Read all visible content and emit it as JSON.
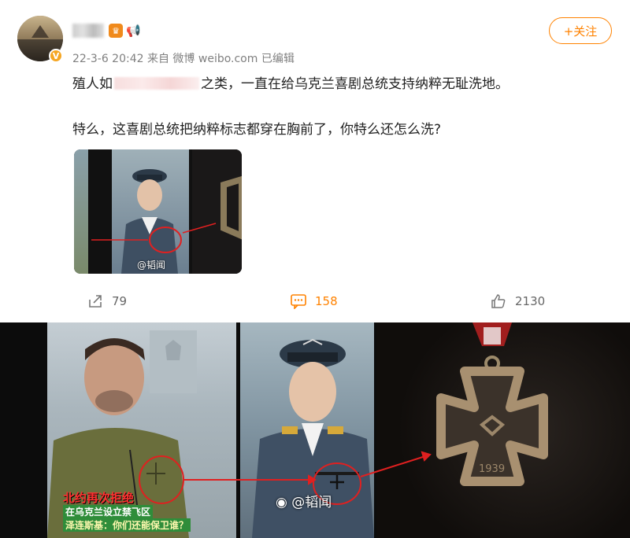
{
  "post": {
    "username_redacted": true,
    "verified_badge": "V",
    "level_badge": "♛",
    "meta": "22-3-6 20:42 来自 微博 weibo.com 已编辑",
    "follow_label": "+关注",
    "line1_before": "殖人如",
    "line1_after": "之类，一直在给乌克兰喜剧总统支持纳粹无耻洗地。",
    "line2": "特么，这喜剧总统把纳粹标志都穿在胸前了，你特么还怎么洗?",
    "thumb_watermark": "@韬闻",
    "actions": {
      "share_count": "79",
      "comment_count": "158",
      "like_count": "2130"
    }
  },
  "large_image": {
    "caption_red": "北约再次拒绝",
    "caption_green": "在乌克兰设立禁飞区",
    "caption_yellow": "泽连斯基：你们还能保卫谁？",
    "watermark": "@韬闻",
    "medal_year": "1939"
  },
  "colors": {
    "accent": "#ff8200",
    "text": "#222222",
    "meta": "#808080",
    "highlight_red": "#e02020"
  },
  "icons": [
    "verified-icon",
    "level-icon",
    "horn-icon",
    "share-icon",
    "comment-icon",
    "like-icon",
    "weibo-logo-icon"
  ]
}
